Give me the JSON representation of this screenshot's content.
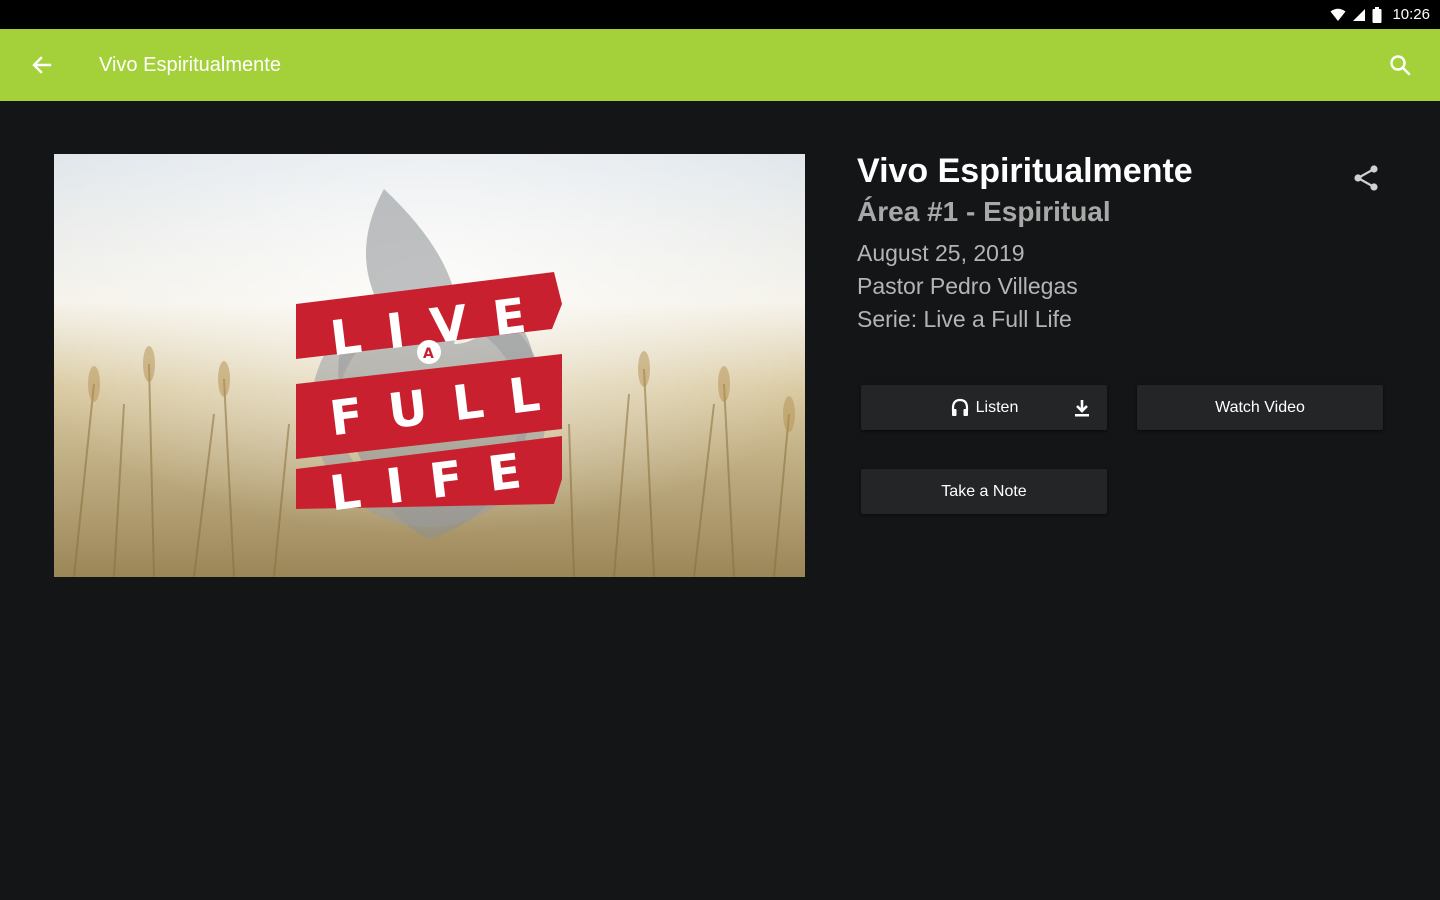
{
  "status_bar": {
    "time": "10:26"
  },
  "app_bar": {
    "title": "Vivo Espiritualmente",
    "accent_color": "#a4d13a",
    "back_icon": "arrow-back-icon",
    "search_icon": "search-icon"
  },
  "sermon": {
    "title": "Vivo Espiritualmente",
    "subtitle": "Área #1 - Espiritual",
    "date": "August 25, 2019",
    "speaker": "Pastor Pedro Villegas",
    "series": "Serie: Live a Full Life",
    "share_icon": "share-icon"
  },
  "artwork": {
    "line1": "LIVE",
    "line2": "FULL",
    "line3": "LIFE",
    "badge": "A",
    "banner_color": "#c8202f"
  },
  "actions": {
    "listen_label": "Listen",
    "watch_label": "Watch Video",
    "note_label": "Take a Note"
  }
}
